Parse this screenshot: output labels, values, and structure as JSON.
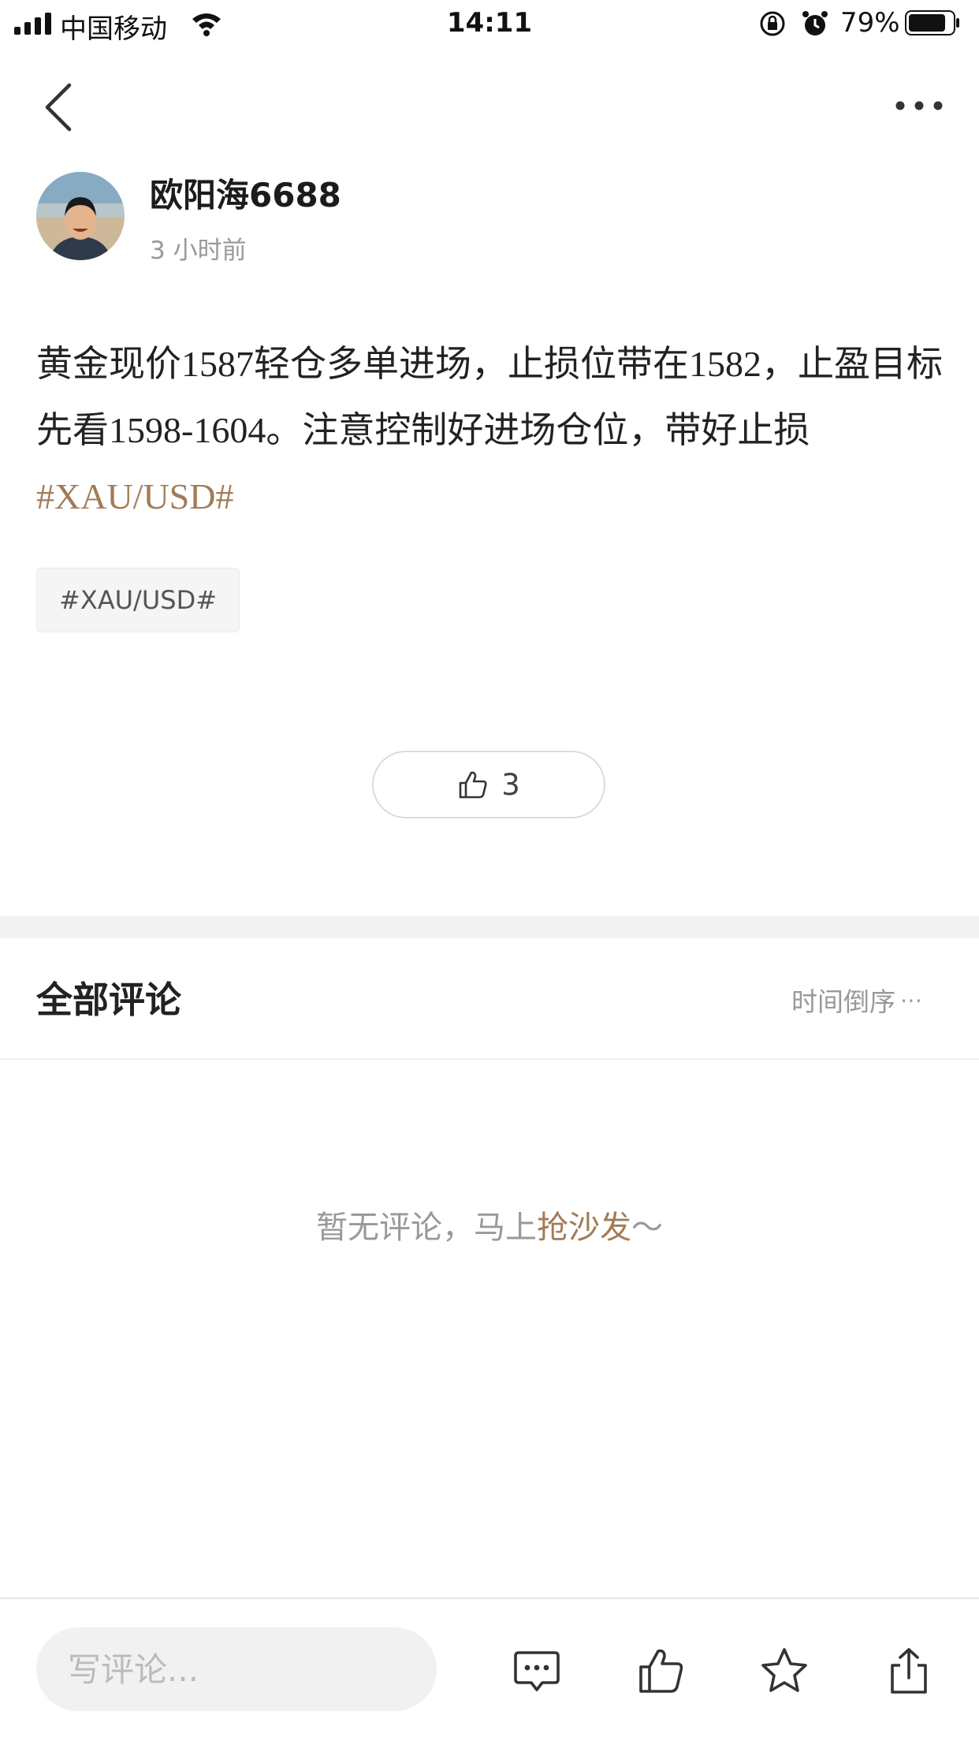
{
  "status_bar": {
    "carrier": "中国移动",
    "time": "14:11",
    "battery_percent": "79%"
  },
  "author": {
    "name": "欧阳海6688",
    "time_ago": "3 小时前"
  },
  "post": {
    "text": "黄金现价1587轻仓多单进场，止损位带在1582，止盈目标先看1598-1604。注意控制好进场仓位，带好止损",
    "inline_hashtag": "#XAU/USD#",
    "tag_chip": "#XAU/USD#",
    "like_count": "3"
  },
  "comments": {
    "title": "全部评论",
    "sort_label": "时间倒序",
    "sort_dots": "⋯",
    "empty_prefix": "暂无评论，马上",
    "empty_link": "抢沙发",
    "empty_suffix": "～"
  },
  "bottom_bar": {
    "input_placeholder": "写评论..."
  },
  "icons": {
    "back": "chevron-left-icon",
    "more": "more-horizontal-icon",
    "like": "thumbs-up-icon",
    "comment": "comment-bubble-icon",
    "favorite": "star-icon",
    "share": "share-icon"
  },
  "colors": {
    "accent": "#a27c57",
    "muted_text": "#999999",
    "divider_band": "#f2f2f2"
  }
}
